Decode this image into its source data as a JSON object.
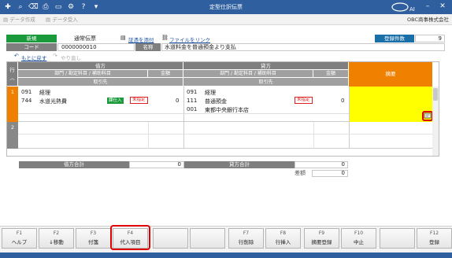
{
  "window": {
    "title": "定型仕訳伝票"
  },
  "toolbar": {
    "create_label": "データ作成",
    "receive_label": "データ受入",
    "company": "OBC商事株式会社"
  },
  "header": {
    "new_badge": "新規",
    "slip_type": "通常伝票",
    "attach_label": "証憑を添付",
    "link_label": "ファイルをリンク",
    "count_label": "登録件数",
    "count_value": "9",
    "code_label": "コード",
    "code_value": "0000000010",
    "name_label": "名称",
    "name_value": "水道料金を普通預金より支払",
    "back_label": "もとに戻す",
    "redo_label": "やり直し"
  },
  "grid": {
    "col_row": "行",
    "debit": "借方",
    "credit": "貸方",
    "memo": "摘要",
    "sub_headers": "部門 / 勘定科目 / 補助科目",
    "amount": "金額",
    "partner": "取引先",
    "rows": [
      {
        "no": "1",
        "debit_dept_code": "091",
        "debit_dept": "経理",
        "debit_acct_code": "744",
        "debit_acct": "水道光熱費",
        "debit_tax_tag": "課仕入",
        "debit_amount_tag": "未指定",
        "debit_amount": "0",
        "credit_dept_code": "091",
        "credit_dept": "経理",
        "credit_acct_code": "111",
        "credit_acct": "普通預金",
        "credit_sub_code": "001",
        "credit_sub": "東都中央銀行本店",
        "credit_amount_tag": "未指定",
        "credit_amount": "0"
      },
      {
        "no": "2"
      }
    ]
  },
  "totals": {
    "debit_label": "借方合計",
    "debit_value": "0",
    "credit_label": "貸方合計",
    "credit_value": "0",
    "diff_label": "差額",
    "diff_value": "0"
  },
  "fkeys": [
    {
      "key": "F1",
      "label": "ヘルプ"
    },
    {
      "key": "F2",
      "label": "↓移動"
    },
    {
      "key": "F3",
      "label": "付箋"
    },
    {
      "key": "F4",
      "label": "代入項目"
    },
    {
      "key": "",
      "label": ""
    },
    {
      "key": "",
      "label": ""
    },
    {
      "key": "F7",
      "label": "行削除"
    },
    {
      "key": "F8",
      "label": "行挿入"
    },
    {
      "key": "F9",
      "label": "摘要登録"
    },
    {
      "key": "F10",
      "label": "中止"
    },
    {
      "key": "",
      "label": ""
    },
    {
      "key": "F12",
      "label": "登録"
    }
  ],
  "colors": {
    "titlebar": "#2f5f9e",
    "accent_orange": "#f08000",
    "memo_yellow": "#ffff00",
    "highlight_red": "#e00000"
  }
}
